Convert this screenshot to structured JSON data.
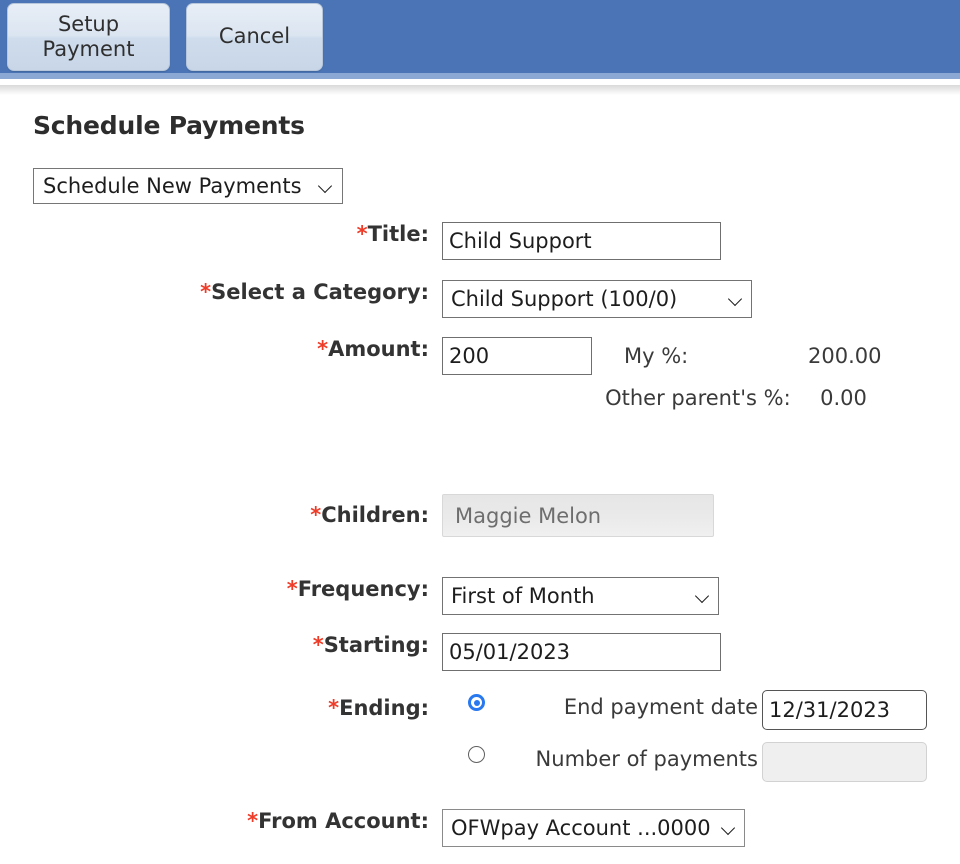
{
  "toolbar": {
    "setup_payment_label": "Setup\nPayment",
    "setup_payment_line1": "Setup",
    "setup_payment_line2": "Payment",
    "cancel_label": "Cancel",
    "bar_color": "#4a74b5"
  },
  "page": {
    "title": "Schedule Payments",
    "mode_select_value": "Schedule New Payments",
    "required_marker": "*",
    "required_color": "#ef3c28"
  },
  "form": {
    "title": {
      "label": "Title:",
      "value": "Child Support"
    },
    "category": {
      "label": "Select a Category:",
      "value": "Child Support (100/0)"
    },
    "amount": {
      "label": "Amount:",
      "value": "200",
      "my_pct_label": "My %:",
      "my_pct_value": "200.00",
      "other_pct_label": "Other parent's %:",
      "other_pct_value": "0.00"
    },
    "children": {
      "label": "Children:",
      "value": "Maggie Melon"
    },
    "frequency": {
      "label": "Frequency:",
      "value": "First of Month"
    },
    "starting": {
      "label": "Starting:",
      "value": "05/01/2023"
    },
    "ending": {
      "label": "Ending:",
      "option_date_label": "End payment date",
      "option_date_value": "12/31/2023",
      "option_date_selected": true,
      "option_count_label": "Number of payments",
      "option_count_value": "",
      "option_count_selected": false
    },
    "from_account": {
      "label": "From Account:",
      "value": "OFWpay Account ...0000"
    }
  }
}
